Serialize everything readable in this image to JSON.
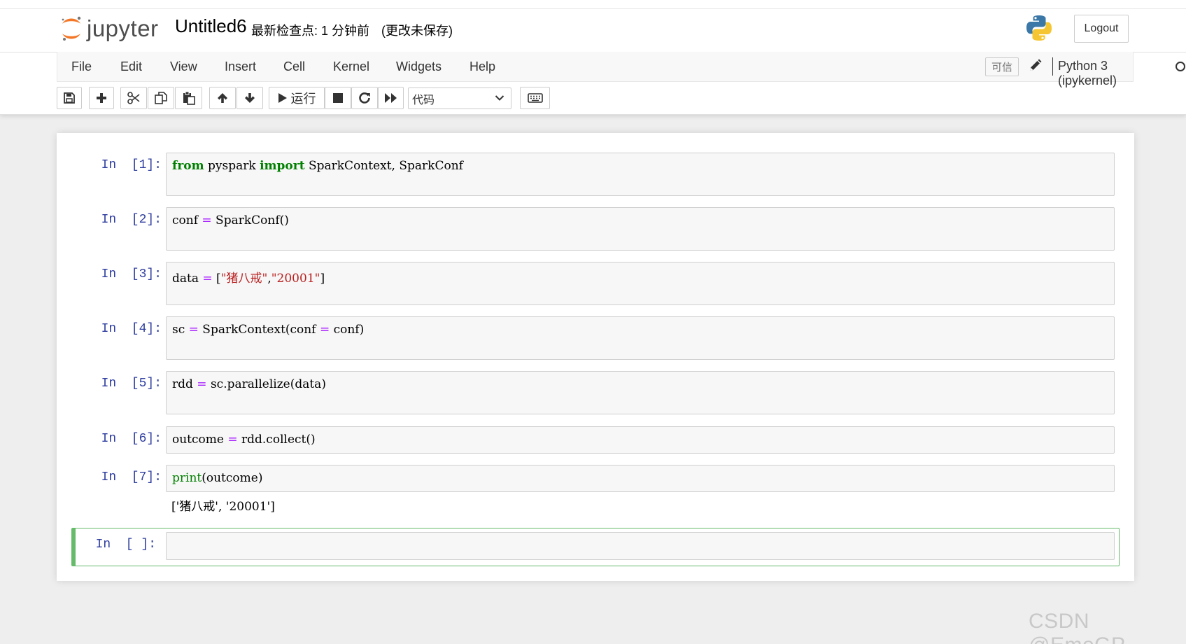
{
  "header": {
    "logo_text": "jupyter",
    "notebook_name": "Untitled6",
    "checkpoint": "最新检查点: 1 分钟前",
    "unsaved": "(更改未保存)",
    "logout_label": "Logout"
  },
  "menu": {
    "items": [
      "File",
      "Edit",
      "View",
      "Insert",
      "Cell",
      "Kernel",
      "Widgets",
      "Help"
    ],
    "trusted_label": "可信",
    "kernel_name": "Python 3 (ipykernel)"
  },
  "toolbar": {
    "buttons": [
      "save-icon",
      "plus-icon",
      "cut-icon",
      "copy-icon",
      "paste-icon",
      "arrow-up-icon",
      "arrow-down-icon",
      "run-icon",
      "stop-icon",
      "restart-icon",
      "fast-forward-icon",
      "keyboard-icon"
    ],
    "run_label": "运行",
    "cell_type": "代码"
  },
  "cells": [
    {
      "prompt": "In  [1]:",
      "tokens": [
        [
          "kw",
          "from"
        ],
        [
          "",
          " pyspark "
        ],
        [
          "kw",
          "import"
        ],
        [
          "",
          " SparkContext, SparkConf"
        ]
      ]
    },
    {
      "prompt": "In  [2]:",
      "tokens": [
        [
          "",
          "conf "
        ],
        [
          "op",
          "="
        ],
        [
          "",
          " SparkConf()"
        ]
      ]
    },
    {
      "prompt": "In  [3]:",
      "tokens": [
        [
          "",
          "data "
        ],
        [
          "op",
          "="
        ],
        [
          "",
          " ["
        ],
        [
          "str",
          "\"猪八戒\""
        ],
        [
          "",
          ","
        ],
        [
          "str",
          "\"20001\""
        ],
        [
          "",
          "]"
        ]
      ]
    },
    {
      "prompt": "In  [4]:",
      "tokens": [
        [
          "",
          "sc "
        ],
        [
          "op",
          "="
        ],
        [
          "",
          " SparkContext(conf "
        ],
        [
          "op",
          "="
        ],
        [
          "",
          " conf)"
        ]
      ]
    },
    {
      "prompt": "In  [5]:",
      "tokens": [
        [
          "",
          "rdd "
        ],
        [
          "op",
          "="
        ],
        [
          "",
          " sc.parallelize(data)"
        ]
      ]
    },
    {
      "prompt": "In  [6]:",
      "tokens": [
        [
          "",
          "outcome "
        ],
        [
          "op",
          "="
        ],
        [
          "",
          " rdd.collect()"
        ]
      ]
    },
    {
      "prompt": "In  [7]:",
      "tokens": [
        [
          "bi",
          "print"
        ],
        [
          "",
          "(outcome)"
        ]
      ],
      "output": "['猪八戒', '20001']"
    },
    {
      "prompt": "In  [ ]:",
      "tokens": []
    }
  ],
  "watermark": "CSDN @EmoGP",
  "colors": {
    "prompt": "#303f9f",
    "keyword": "#008000",
    "operator": "#aa22ff",
    "string": "#ba2121",
    "selected_border": "#66bb6a"
  }
}
